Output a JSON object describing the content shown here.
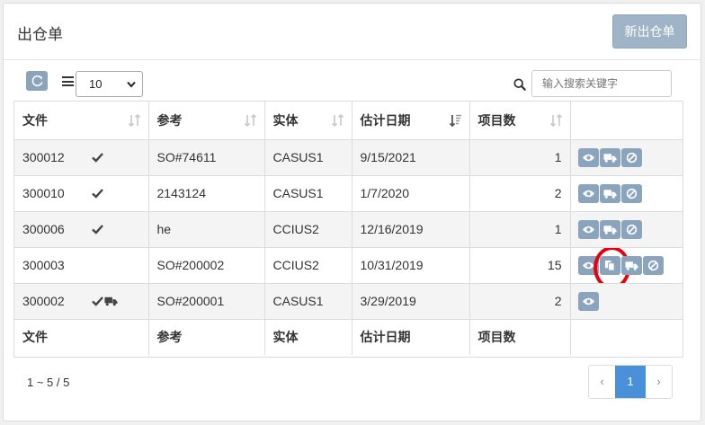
{
  "header": {
    "title": "出仓单",
    "new_button": "新出仓单"
  },
  "toolbar": {
    "page_size": "10",
    "search_placeholder": "输入搜索关键字"
  },
  "table": {
    "columns": [
      "文件",
      "参考",
      "实体",
      "估计日期",
      "项目数",
      ""
    ],
    "rows": [
      {
        "file": "300012",
        "ref": "SO#74611",
        "entity": "CASUS1",
        "date": "9/15/2021",
        "items": "1",
        "check": true,
        "truck": false,
        "actions": [
          "eye",
          "truck",
          "ban"
        ]
      },
      {
        "file": "300010",
        "ref": "2143124",
        "entity": "CASUS1",
        "date": "1/7/2020",
        "items": "2",
        "check": true,
        "truck": false,
        "actions": [
          "eye",
          "truck",
          "ban"
        ]
      },
      {
        "file": "300006",
        "ref": "he",
        "entity": "CCIUS2",
        "date": "12/16/2019",
        "items": "1",
        "check": true,
        "truck": false,
        "actions": [
          "eye",
          "truck",
          "ban"
        ]
      },
      {
        "file": "300003",
        "ref": "SO#200002",
        "entity": "CCIUS2",
        "date": "10/31/2019",
        "items": "15",
        "check": false,
        "truck": false,
        "actions": [
          "eye",
          "copy",
          "truck",
          "ban"
        ]
      },
      {
        "file": "300002",
        "ref": "SO#200001",
        "entity": "CASUS1",
        "date": "3/29/2019",
        "items": "2",
        "check": true,
        "truck": true,
        "actions": [
          "eye"
        ]
      }
    ],
    "footer": [
      "文件",
      "参考",
      "实体",
      "估计日期",
      "项目数",
      ""
    ]
  },
  "pagination": {
    "info": "1 ~ 5 / 5",
    "prev": "‹",
    "current": "1",
    "next": "›"
  }
}
